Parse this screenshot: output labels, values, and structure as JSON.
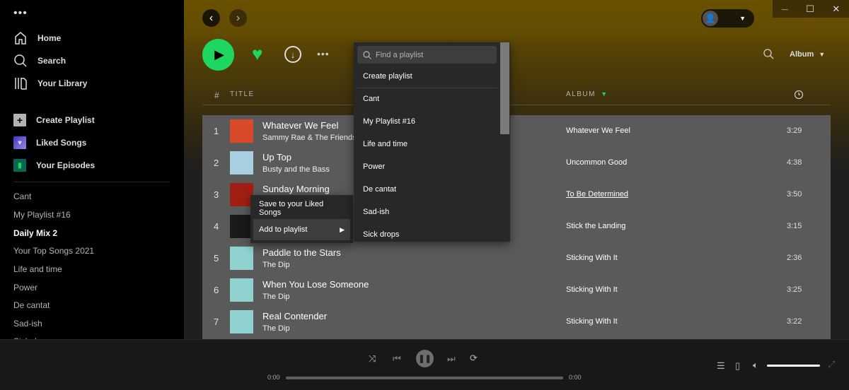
{
  "sidebar": {
    "more": "•••",
    "nav": [
      {
        "label": "Home",
        "icon": "home-icon"
      },
      {
        "label": "Search",
        "icon": "search-icon"
      },
      {
        "label": "Your Library",
        "icon": "library-icon"
      }
    ],
    "actions": [
      {
        "label": "Create Playlist",
        "icon": "plus-icon",
        "color": "#b3b3b3"
      },
      {
        "label": "Liked Songs",
        "icon": "heart-icon",
        "color": "#6b4fd8"
      },
      {
        "label": "Your Episodes",
        "icon": "bookmark-icon",
        "color": "#056952"
      }
    ],
    "playlists": [
      "Cant",
      "My Playlist #16",
      "Daily Mix 2",
      "Your Top Songs 2021",
      "Life and time",
      "Power",
      "De cantat",
      "Sad-ish",
      "Sick drops"
    ],
    "active_playlist": "Daily Mix 2"
  },
  "topbar": {
    "back": "‹",
    "forward": "›",
    "window": {
      "minimize": "—",
      "maximize": "☐",
      "close": "✕"
    }
  },
  "actionbar": {
    "sort_label": "Album",
    "accent": "#1ed760"
  },
  "table": {
    "headers": {
      "num": "#",
      "title": "TITLE",
      "album": "ALBUM"
    },
    "rows": [
      {
        "n": "1",
        "title": "Whatever We Feel",
        "artist": "Sammy Rae & The Friends",
        "album": "Whatever We Feel",
        "duration": "3:29",
        "art": "#d84a2a"
      },
      {
        "n": "2",
        "title": "Up Top",
        "artist": "Busty and the Bass",
        "album": "Uncommon Good",
        "duration": "4:38",
        "art": "#a8cfe0"
      },
      {
        "n": "3",
        "title": "Sunday Morning",
        "artist": "",
        "album": "To Be Determined",
        "duration": "3:50",
        "art": "#a01e12"
      },
      {
        "n": "4",
        "title": "",
        "artist": "",
        "album": "Stick the Landing",
        "duration": "3:15",
        "art": "#1a1a1a"
      },
      {
        "n": "5",
        "title": "Paddle to the Stars",
        "artist": "The Dip",
        "album": "Sticking With It",
        "duration": "2:36",
        "art": "#8fd2d0"
      },
      {
        "n": "6",
        "title": "When You Lose Someone",
        "artist": "The Dip",
        "album": "Sticking With It",
        "duration": "3:25",
        "art": "#8fd2d0"
      },
      {
        "n": "7",
        "title": "Real Contender",
        "artist": "The Dip",
        "album": "Sticking With It",
        "duration": "3:22",
        "art": "#8fd2d0"
      }
    ]
  },
  "context_menu": {
    "items": [
      "Save to your Liked Songs",
      "Add to playlist"
    ]
  },
  "submenu": {
    "search_placeholder": "Find a playlist",
    "create": "Create playlist",
    "items": [
      "Cant",
      "My Playlist #16",
      "Life and time",
      "Power",
      "De cantat",
      "Sad-ish",
      "Sick drops"
    ]
  },
  "player": {
    "elapsed": "0:00",
    "total": "0:00",
    "progress": 0,
    "volume": 1.0
  }
}
